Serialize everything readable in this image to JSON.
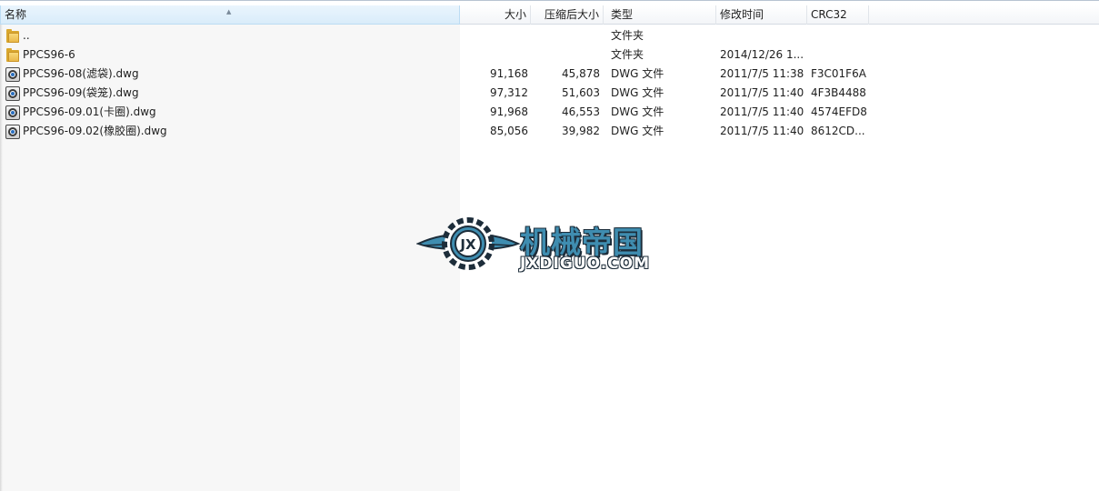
{
  "columns": {
    "name": "名称",
    "size": "大小",
    "packed": "压缩后大小",
    "type": "类型",
    "modified": "修改时间",
    "crc": "CRC32"
  },
  "rows": [
    {
      "icon": "folder-icon",
      "name": "..",
      "size": "",
      "packed": "",
      "type": "文件夹",
      "modified": "",
      "crc": ""
    },
    {
      "icon": "folder-icon",
      "name": "PPCS96-6",
      "size": "",
      "packed": "",
      "type": "文件夹",
      "modified": "2014/12/26 1...",
      "crc": ""
    },
    {
      "icon": "dwg-file-icon",
      "name": "PPCS96-08(滤袋).dwg",
      "size": "91,168",
      "packed": "45,878",
      "type": "DWG 文件",
      "modified": "2011/7/5 11:38",
      "crc": "F3C01F6A"
    },
    {
      "icon": "dwg-file-icon",
      "name": "PPCS96-09(袋笼).dwg",
      "size": "97,312",
      "packed": "51,603",
      "type": "DWG 文件",
      "modified": "2011/7/5 11:40",
      "crc": "4F3B4488"
    },
    {
      "icon": "dwg-file-icon",
      "name": "PPCS96-09.01(卡圈).dwg",
      "size": "91,968",
      "packed": "46,553",
      "type": "DWG 文件",
      "modified": "2011/7/5 11:40",
      "crc": "4574EFD8"
    },
    {
      "icon": "dwg-file-icon",
      "name": "PPCS96-09.02(橡胶圈).dwg",
      "size": "85,056",
      "packed": "39,982",
      "type": "DWG 文件",
      "modified": "2011/7/5 11:40",
      "crc": "8612CD..."
    }
  ],
  "watermark": {
    "title": "机械帝国",
    "subtitle": "JXDIGUO.COM",
    "emblem": "JX"
  },
  "colors": {
    "sorted_header": "#d9ecfa",
    "logo_blue": "#3f8db0"
  }
}
